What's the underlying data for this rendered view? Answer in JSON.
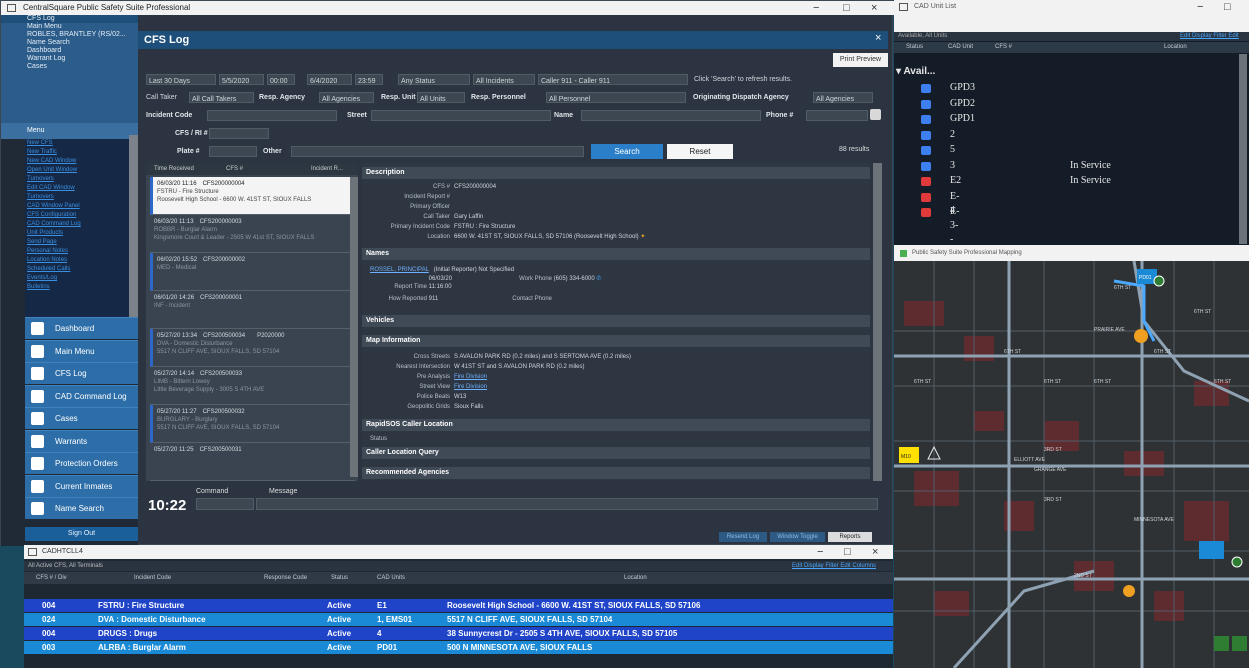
{
  "main_window": {
    "title": "CentralSquare Public Safety Suite Professional"
  },
  "sidebar": {
    "top_items": [
      "CFS Log",
      "Main Menu",
      "ROBLES, BRANTLEY (RS/02...",
      "Name Search",
      "Dashboard",
      "Warrant Log",
      "Cases"
    ],
    "menu_label": "Menu",
    "menu_links": [
      "New CFS",
      "New Traffic",
      "New CAD Window",
      "Open Unit Window",
      "Turnovers",
      "Edit CAD Window",
      "Turnovers",
      "CAD Window Panel",
      "CFS Configuration",
      "CAD Command Log",
      "Unit Products",
      "Send Page",
      "Personal Notes",
      "Location Notes",
      "Scheduled Calls",
      "Events/Log",
      "Bulletins"
    ],
    "nav": [
      {
        "label": "Dashboard",
        "icon": "dashboard-icon"
      },
      {
        "label": "Main Menu",
        "icon": "menu-icon"
      },
      {
        "label": "CFS Log",
        "icon": "phone-icon"
      },
      {
        "label": "CAD Command Log",
        "icon": "log-icon"
      },
      {
        "label": "Cases",
        "icon": "folder-icon"
      },
      {
        "label": "Warrants",
        "icon": "warrant-icon"
      },
      {
        "label": "Protection Orders",
        "icon": "shield-icon"
      },
      {
        "label": "Current Inmates",
        "icon": "inmate-icon"
      },
      {
        "label": "Name Search",
        "icon": "person-search-icon"
      }
    ],
    "sign_out": "Sign Out"
  },
  "cfs": {
    "header": "CFS Log",
    "print_preview": "Print Preview",
    "filter": {
      "date_range": "Last 30 Days",
      "from_date": "5/5/2020",
      "from_time": "00:00",
      "to_date": "6/4/2020",
      "to_time": "23:59",
      "status": "Any Status",
      "incidents": "All Incidents",
      "callers": "Caller 911 - Caller 911",
      "hint": "Click 'Search' to refresh results."
    },
    "labels": {
      "call_taker": "Call Taker",
      "resp_agency": "Resp. Agency",
      "resp_unit": "Resp. Unit",
      "resp_personnel": "Resp. Personnel",
      "originating": "Originating Dispatch Agency",
      "incident_code": "Incident Code",
      "street": "Street",
      "name": "Name",
      "phone": "Phone #",
      "cfs_ri": "CFS / RI #",
      "plate": "Plate #",
      "other": "Other"
    },
    "values": {
      "call_taker": "All Call Takers",
      "resp_agency": "All Agencies",
      "resp_unit": "All Units",
      "resp_personnel": "All Personnel",
      "originating": "All Agencies"
    },
    "search": "Search",
    "reset": "Reset",
    "results": "88 results",
    "list_head": [
      "Time Received",
      "CFS #",
      "Incident R..."
    ],
    "list": [
      {
        "t": "06/03/20 11:16",
        "cfs": "CFS200000004",
        "l1": "FSTRU - Fire Structure",
        "l2": "Roosevelt High School - 6600 W. 41ST ST, SIOUX FALLS"
      },
      {
        "t": "06/03/20 11:13",
        "cfs": "CFS200000003",
        "l1": "ROBBR - Burglar Alarm",
        "l2": "Kingsmore Court & Leader - 2505 W 41st ST, SIOUX FALLS"
      },
      {
        "t": "06/02/20 15:52",
        "cfs": "CFS200000002",
        "l1": "MED - Medical",
        "l2": ""
      },
      {
        "t": "06/01/20 14:26",
        "cfs": "CFS200000001",
        "l1": "INF - Incident",
        "l2": ""
      },
      {
        "t": "05/27/20 13:34",
        "cfs": "CFS200500034",
        "extra": "P2020000",
        "l1": "DVA - Domestic Disturbance",
        "l2": "5517 N CLIFF AVE, SIOUX FALLS, SD 57104"
      },
      {
        "t": "05/27/20 14:14",
        "cfs": "CFS200500033",
        "l1": "LIMB - Bittern Lowey",
        "l2": "Little Beverage Supply - 3005 S 4TH AVE"
      },
      {
        "t": "05/27/20 11:27",
        "cfs": "CFS200500032",
        "l1": "BURGLARY - Burglary",
        "l2": "5517 N CLIFF AVE, SIOUX FALLS, SD 57104"
      },
      {
        "t": "05/27/20 11:25",
        "cfs": "CFS200500031",
        "l1": "",
        "l2": ""
      }
    ],
    "detail": {
      "sections": {
        "description": "Description",
        "names": "Names",
        "vehicles": "Vehicles",
        "map_info": "Map Information",
        "rapidsos": "RapidSOS Caller Location",
        "caller_query": "Caller Location Query",
        "agencies": "Recommended Agencies"
      },
      "desc": [
        [
          "CFS #",
          "CFS200000004"
        ],
        [
          "Incident Report #",
          ""
        ],
        [
          "Primary Officer",
          ""
        ],
        [
          "Call Taker",
          "Gary Laffin"
        ],
        [
          "Primary Incident Code",
          "FSTRU : Fire Structure"
        ],
        [
          "Location",
          "6600 W. 41ST ST, SIOUX FALLS, SD 57106 (Roosevelt High School)"
        ]
      ],
      "names_line": "ROSSEL, PRINCIPAL",
      "names_role": "(Initial Reporter)  Not Specified",
      "report_time_k": "Report Time",
      "report_time": "06/03/20 11:16:00",
      "phone_k": "Work Phone",
      "phone": "(605) 334-6000",
      "how_k": "How Reported",
      "how": "911",
      "contact_k": "Contact Phone",
      "mapinfo": [
        [
          "Cross Streets",
          "S AVALON PARK RD (0.2 miles) and S SERTOMA AVE (0.2 miles)"
        ],
        [
          "Nearest Intersection",
          "W 41ST ST and S AVALON PARK RD (0.2 miles)"
        ],
        [
          "Pre Analysis",
          "Fire Division"
        ],
        [
          "Street View",
          "Fire Division"
        ],
        [
          "Police Beats",
          "W13"
        ],
        [
          "Geopolitic Grids",
          "Sioux Falls"
        ]
      ],
      "status_k": "Status"
    },
    "command": {
      "time": "10:22",
      "command_label": "Command",
      "message_label": "Message"
    },
    "bottom_btns": [
      "Resend Log",
      "Window Toggle",
      "Reports"
    ]
  },
  "cad": {
    "title": "CADHTCLL4",
    "subtitle": "All Active CFS, All Terminals",
    "links": "Edit Display Filter   Edit Columns",
    "head": [
      "CFS # / Div",
      "Incident Code",
      "Response Code",
      "Status",
      "CAD Units",
      "Location"
    ],
    "rows": [
      {
        "id": "004",
        "code": "FSTRU : Fire Structure",
        "status": "Active",
        "units": "E1",
        "loc": "Roosevelt High School - 6600 W. 41ST ST, SIOUX FALLS, SD 57106",
        "bg": "#1f44c8"
      },
      {
        "id": "024",
        "code": "DVA : Domestic Disturbance",
        "status": "Active",
        "units": "1, EMS01",
        "loc": "5517 N CLIFF AVE, SIOUX FALLS, SD 57104",
        "bg": "#1a8ad6"
      },
      {
        "id": "004",
        "code": "DRUGS : Drugs",
        "status": "Active",
        "units": "4",
        "loc": "38 Sunnycrest Dr - 2505 S 4TH AVE, SIOUX FALLS, SD 57105",
        "bg": "#1f44c8"
      },
      {
        "id": "003",
        "code": "ALRBA : Burglar Alarm",
        "status": "Active",
        "units": "PD01",
        "loc": "500 N MINNESOTA AVE, SIOUX FALLS",
        "bg": "#1a8ad6"
      }
    ]
  },
  "units": {
    "title": "CAD Unit List",
    "subtitle": "Available, All Units",
    "links": "Edit Display Filter  Edit",
    "head": [
      "Status",
      "CAD Unit",
      "CFS #",
      "Location"
    ],
    "group": "Avail...",
    "items": [
      {
        "name": "GPD3",
        "status": "",
        "color": "#3e7ff0"
      },
      {
        "name": "GPD2",
        "status": "",
        "color": "#3e7ff0"
      },
      {
        "name": "GPD1",
        "status": "",
        "color": "#3e7ff0"
      },
      {
        "name": "2",
        "status": "",
        "color": "#3e7ff0"
      },
      {
        "name": "5",
        "status": "",
        "color": "#3e7ff0"
      },
      {
        "name": "3",
        "status": "In Service",
        "color": "#3e7ff0"
      },
      {
        "name": "E2",
        "status": "In Service",
        "color": "#e03a3a"
      },
      {
        "name": "E-4",
        "status": "",
        "color": "#e03a3a"
      },
      {
        "name": "E-3--",
        "status": "",
        "color": "#e03a3a"
      }
    ]
  },
  "map": {
    "title": "Public Safety Suite Professional Mapping",
    "streets": [
      "PRAIRIE AVE",
      "PRAIRIE AVE",
      "6TH ST",
      "6TH ST",
      "6TH ST",
      "6TH ST",
      "6TH ST",
      "6TH ST",
      "6TH ST",
      "6TH ST",
      "3RD ST",
      "3RD ST",
      "2ND ST",
      "ELLIOTT AVE",
      "GRANGE AVE",
      "MINNESOTA AVE"
    ],
    "markers": [
      "PD01",
      "M10",
      "B"
    ]
  }
}
